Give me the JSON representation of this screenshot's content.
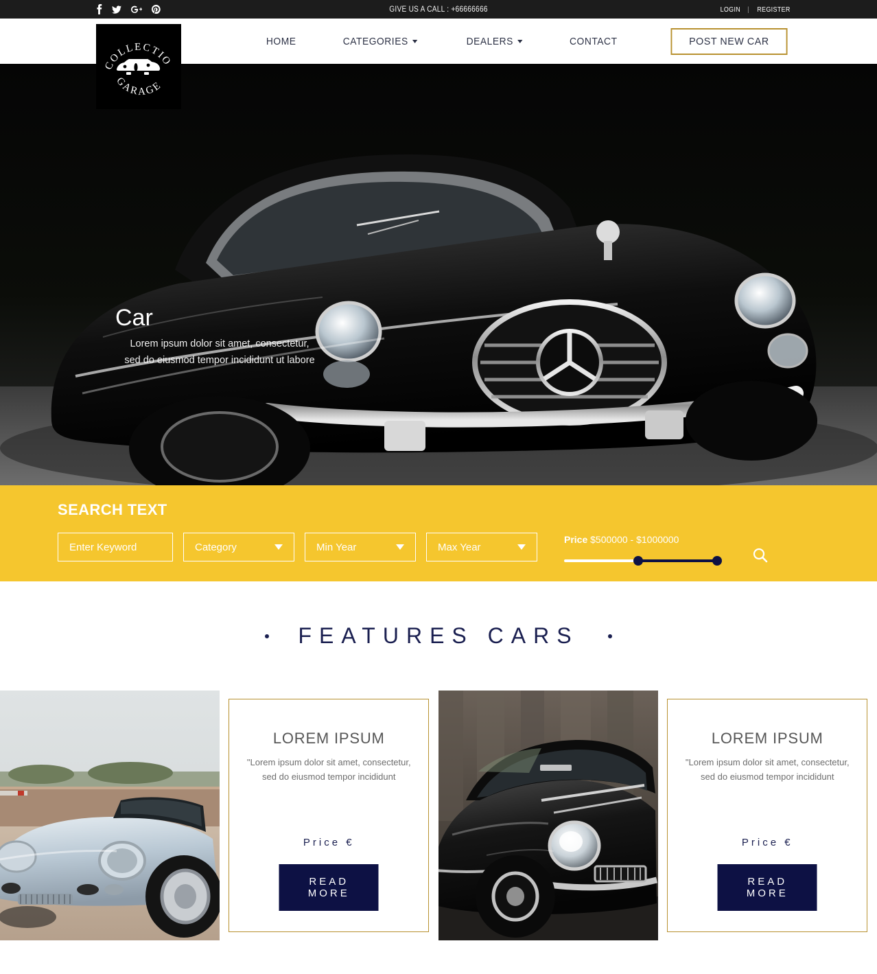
{
  "topbar": {
    "social": [
      {
        "name": "facebook-icon",
        "glyph": "f"
      },
      {
        "name": "twitter-icon",
        "glyph": "t"
      },
      {
        "name": "google-plus-icon",
        "glyph": "G+"
      },
      {
        "name": "pinterest-icon",
        "glyph": "P"
      }
    ],
    "phone_text": "GIVE US A CALL : +66666666",
    "login_label": "LOGIN",
    "separator": "|",
    "register_label": "REGISTER"
  },
  "header": {
    "logo": {
      "top_text": "COLLECTION",
      "bottom_text": "GARAGE",
      "icon": "car-silhouette-icon"
    },
    "nav": [
      {
        "label": "HOME",
        "has_caret": false
      },
      {
        "label": "CATEGORIES",
        "has_caret": true
      },
      {
        "label": "DEALERS",
        "has_caret": true
      },
      {
        "label": "CONTACT",
        "has_caret": false
      }
    ],
    "post_button": "POST NEW CAR",
    "accent_gold": "#b8912f"
  },
  "hero": {
    "title": "Car",
    "subtitle_line1": "Lorem ipsum dolor sit amet, consectetur,",
    "subtitle_line2": "sed do eiusmod tempor incididunt ut labore",
    "image_alt": "classic-black-mercedes-convertible"
  },
  "search": {
    "heading": "SEARCH TEXT",
    "background": "#f5c62e",
    "keyword_placeholder": "Enter Keyword",
    "category_value": "Category",
    "min_year_value": "Min Year",
    "max_year_value": "Max Year",
    "price_label": "Price",
    "price_range": "$500000 - $1000000",
    "price_min": 500000,
    "price_max": 1000000,
    "search_icon": "search-icon"
  },
  "features": {
    "title": "FEATURES CARS",
    "cards": [
      {
        "type": "image",
        "image_alt": "silver-porsche-550-spyder"
      },
      {
        "type": "text",
        "title": "LOREM IPSUM",
        "desc_line1": "\"Lorem ipsum dolor sit amet, consectetur,",
        "desc_line2": "sed do eiusmod tempor incididunt",
        "price": "Price  €",
        "button": "READ MORE"
      },
      {
        "type": "image",
        "image_alt": "dark-classic-porsche-911"
      },
      {
        "type": "text",
        "title": "LOREM IPSUM",
        "desc_line1": "\"Lorem ipsum dolor sit amet, consectetur,",
        "desc_line2": "sed do eiusmod tempor incididunt",
        "price": "Price  €",
        "button": "READ MORE"
      }
    ]
  }
}
